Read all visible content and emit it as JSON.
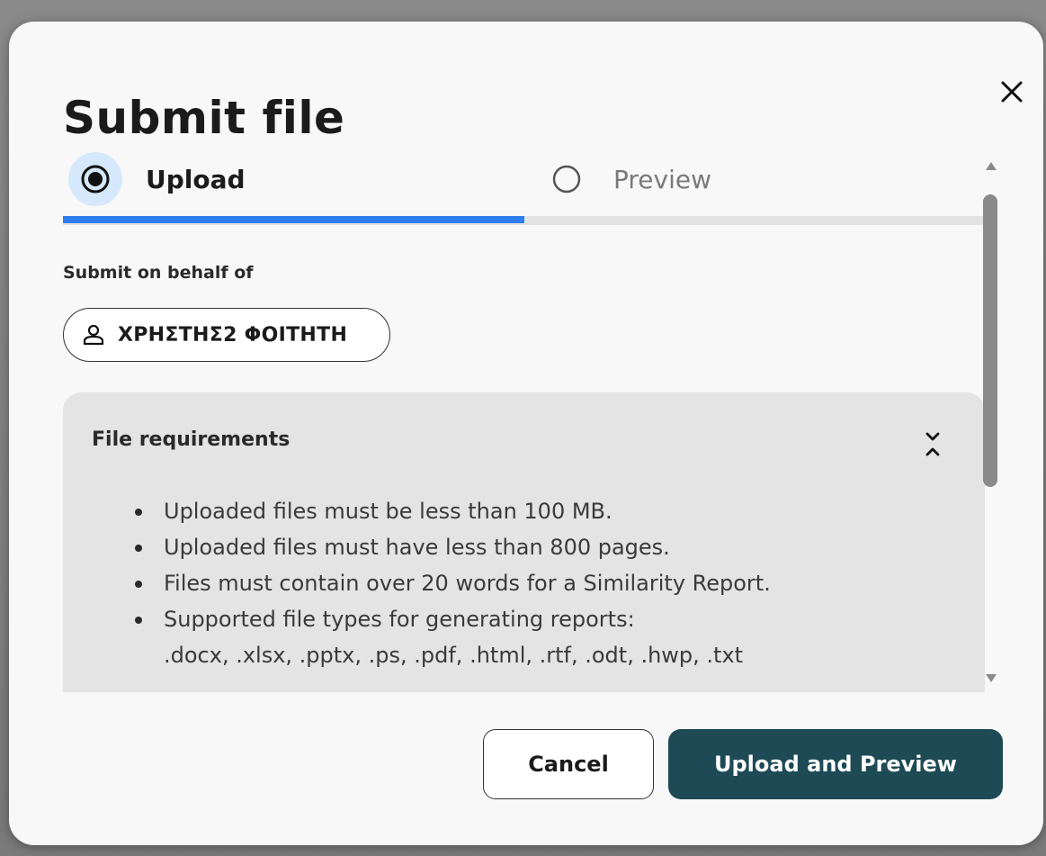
{
  "dialog": {
    "title": "Submit file",
    "close_icon": "close-icon"
  },
  "steps": [
    {
      "label": "Upload",
      "state": "selected",
      "icon": "radio-selected-icon"
    },
    {
      "label": "Preview",
      "state": "unselected",
      "icon": "radio-unselected-icon"
    }
  ],
  "progress": {
    "fraction": 0.5,
    "fill_color": "#2f7ef0",
    "track_color": "#e3e3e3"
  },
  "submit_on_behalf": {
    "label": "Submit on behalf of",
    "user_name": "ΧΡΗΣΤΗΣ2 ΦΟΙΤΗΤΗ",
    "icon": "user-icon"
  },
  "requirements": {
    "title": "File requirements",
    "toggle_icon": "collapse-expand-icon",
    "items": [
      "Uploaded files must be less than 100 MB.",
      "Uploaded files must have less than 800 pages.",
      "Files must contain over 20 words for a Similarity Report.",
      "Supported file types for generating reports:"
    ],
    "file_types": ".docx, .xlsx, .pptx, .ps, .pdf, .html, .rtf, .odt, .hwp, .txt"
  },
  "actions": {
    "cancel_label": "Cancel",
    "primary_label": "Upload and Preview",
    "primary_color": "#1d4a55"
  }
}
